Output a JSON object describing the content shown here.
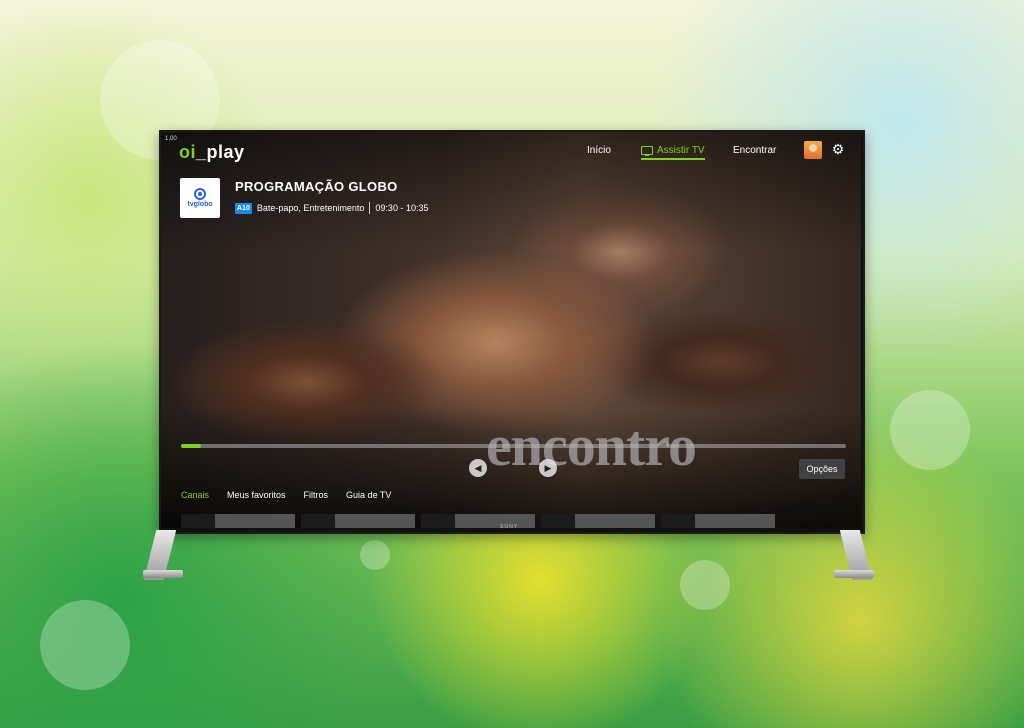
{
  "app": {
    "logo_prefix": "oi",
    "logo_suffix": "_play",
    "corner_tag": "1.00"
  },
  "nav": {
    "inicio": "Início",
    "assistir_tv": "Assistir TV",
    "encontrar": "Encontrar"
  },
  "channel": {
    "logo_text": "tvglobo",
    "program_title": "PROGRAMAÇÃO GLOBO",
    "rating": "A10",
    "genres": "Bate-papo, Entretenimento",
    "time": "09:30 - 10:35"
  },
  "player": {
    "progress_fraction": 0.03,
    "options_label": "Opções",
    "prev_icon": "◀",
    "next_icon": "▶",
    "show_logo": "encontro"
  },
  "tabs": {
    "canais": "Canais",
    "favoritos": "Meus favoritos",
    "filtros": "Filtros",
    "guia": "Guia de TV"
  },
  "device": {
    "brand": "SONY"
  },
  "colors": {
    "accent": "#7ed321",
    "rating_badge": "#1a8ae8"
  },
  "icons": {
    "settings": "gear-icon",
    "tv": "tv-icon"
  }
}
